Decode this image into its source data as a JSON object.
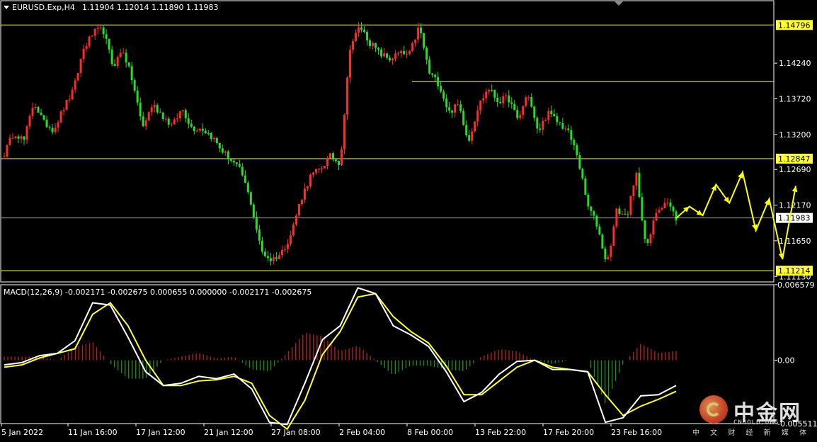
{
  "chart_data": [
    {
      "type": "candlestick",
      "title": "EURUSD.Exp,H4",
      "ohlc_label": "1.11904 1.12014 1.11890 1.11983",
      "last_price": "1.11983",
      "ylim": [
        1.1105,
        1.1515
      ],
      "y_ticks": [
        "1.14240",
        "1.13720",
        "1.13200",
        "1.12690",
        "1.12170",
        "1.11650",
        "1.11130"
      ],
      "x_ticks": [
        "5 Jan 2022",
        "11 Jan 16:00",
        "17 Jan 12:00",
        "21 Jan 12:00",
        "27 Jan 08:00",
        "2 Feb 04:00",
        "8 Feb 00:00",
        "13 Feb 22:00",
        "17 Feb 20:00",
        "23 Feb 16:00"
      ],
      "levels": [
        {
          "label": "1.14796",
          "value": 1.14796
        },
        {
          "label": "1.12847",
          "value": 1.12847
        },
        {
          "label": "1.11214",
          "value": 1.11214
        }
      ],
      "partial_level": {
        "value": 1.1397
      },
      "price_path": [
        1.1292,
        1.1324,
        1.1311,
        1.1368,
        1.1337,
        1.1327,
        1.1358,
        1.1384,
        1.1444,
        1.1468,
        1.1473,
        1.1419,
        1.1444,
        1.1397,
        1.133,
        1.1364,
        1.1348,
        1.1332,
        1.1358,
        1.1329,
        1.1329,
        1.1317,
        1.1297,
        1.1282,
        1.1265,
        1.1219,
        1.115,
        1.1137,
        1.1146,
        1.1174,
        1.1225,
        1.1259,
        1.127,
        1.1288,
        1.1278,
        1.1448,
        1.1478,
        1.1454,
        1.1438,
        1.143,
        1.1438,
        1.1436,
        1.1478,
        1.141,
        1.1394,
        1.1352,
        1.1364,
        1.131,
        1.1362,
        1.1388,
        1.1368,
        1.1374,
        1.134,
        1.1382,
        1.1322,
        1.1352,
        1.1338,
        1.1326,
        1.129,
        1.1218,
        1.1188,
        1.113,
        1.121,
        1.12,
        1.1262,
        1.115,
        1.1208,
        1.1224,
        1.1198
      ],
      "projection": [
        1.1198,
        1.1215,
        1.1202,
        1.1247,
        1.122,
        1.1265,
        1.118,
        1.1226,
        1.1138,
        1.1245
      ],
      "type_secondary": "line",
      "macd": {
        "label": "MACD(12,26,9) -0.002171 -0.002675 0.000655 0.000000 -0.002171 -0.002675",
        "ylim": [
          -0.00551,
          0.00657
        ],
        "y_ticks": [
          "0.006579",
          "0.00",
          "-0.005511"
        ],
        "macd_line": [
          -0.0004,
          -0.0002,
          0.0004,
          0.0006,
          0.0017,
          0.005,
          0.0048,
          0.002,
          -0.001,
          -0.0022,
          -0.002,
          -0.0014,
          -0.0016,
          -0.0012,
          -0.0025,
          -0.0054,
          -0.0056,
          -0.002,
          0.0018,
          0.003,
          0.0063,
          0.0058,
          0.003,
          0.0022,
          0.0012,
          -0.001,
          -0.0036,
          -0.0028,
          -0.0012,
          -0.0001,
          0.0,
          -0.0008,
          -0.0008,
          -0.001,
          -0.0054,
          -0.005,
          -0.0031,
          -0.003,
          -0.0022
        ],
        "signal_line": [
          -0.0006,
          -0.0004,
          0.0002,
          0.0006,
          0.001,
          0.004,
          0.005,
          0.003,
          0.0,
          -0.0022,
          -0.0022,
          -0.0018,
          -0.0017,
          -0.0014,
          -0.002,
          -0.0048,
          -0.006,
          -0.0035,
          0.0005,
          0.0025,
          0.0055,
          0.0058,
          0.0038,
          0.0025,
          0.0015,
          -0.0005,
          -0.003,
          -0.003,
          -0.0018,
          -0.0006,
          0.0,
          -0.0006,
          -0.0008,
          -0.001,
          -0.003,
          -0.0048,
          -0.004,
          -0.0034,
          -0.0027
        ]
      }
    }
  ],
  "colors": {
    "background": "#000000",
    "bull": "#ff2a2a",
    "bear": "#22e022",
    "level": "#ffff33",
    "grid": "#ffffff",
    "projection": "#ffff00",
    "macd": "#ffffff",
    "signal": "#ffff33",
    "hist_pos": "#b02020",
    "hist_neg": "#1e8a1e"
  },
  "watermark": {
    "cn": "中金网",
    "en": "CNGOLD.ORG",
    "sub": "中 文 财 经 新 媒 体"
  }
}
